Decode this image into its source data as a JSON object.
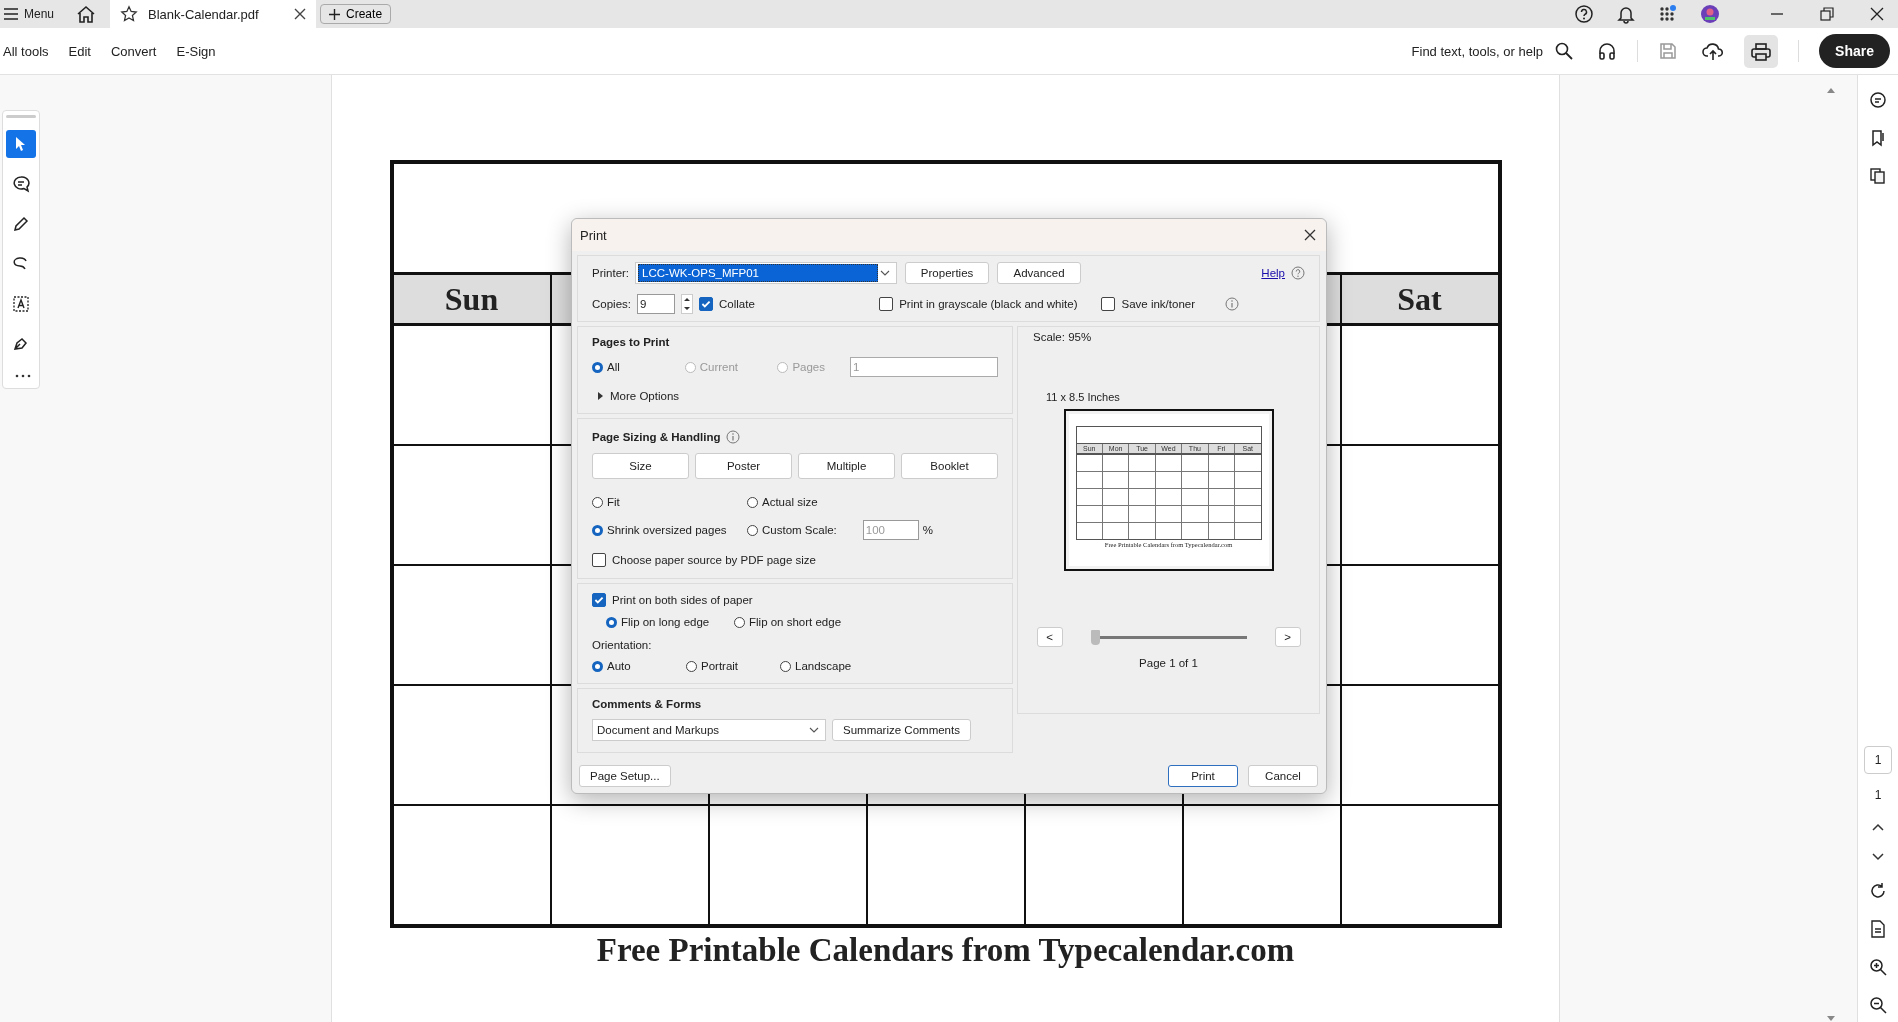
{
  "topbar": {
    "menu": "Menu",
    "tab": {
      "title": "Blank-Calendar.pdf"
    },
    "create": "Create"
  },
  "toolbar": {
    "items": [
      "All tools",
      "Edit",
      "Convert",
      "E-Sign"
    ],
    "search": "Find text, tools, or help",
    "share": "Share"
  },
  "tools": [
    {
      "selected": true
    },
    {
      "selected": false
    },
    {
      "selected": false
    },
    {
      "selected": false
    },
    {
      "selected": false
    },
    {
      "selected": false
    }
  ],
  "calendar": {
    "headers": [
      "Sun",
      "Sat"
    ],
    "footer": "Free Printable Calendars from Typecalendar.com"
  },
  "pager": {
    "current": "1",
    "total": "1"
  },
  "dialog": {
    "title": "Print",
    "printer": {
      "label": "Printer:",
      "value": "LCC-WK-OPS_MFP01"
    },
    "top_buttons": [
      "Properties",
      "Advanced"
    ],
    "help": "Help",
    "copies": {
      "label": "Copies:",
      "value": "9"
    },
    "collate": {
      "label": "Collate",
      "checked": true
    },
    "grayscale": {
      "label": "Print in grayscale (black and white)",
      "checked": false
    },
    "save_ink": {
      "label": "Save ink/toner",
      "checked": false
    },
    "pages_to_print": {
      "title": "Pages to Print",
      "options": [
        {
          "label": "All",
          "selected": true,
          "disabled": false
        },
        {
          "label": "Current",
          "selected": false,
          "disabled": true
        },
        {
          "label": "Pages",
          "selected": false,
          "disabled": true
        }
      ],
      "pages_value": "1",
      "more_options": {
        "label": "More Options",
        "expanded": false
      }
    },
    "sizing": {
      "title": "Page Sizing & Handling",
      "tabs": [
        "Size",
        "Poster",
        "Multiple",
        "Booklet"
      ],
      "options": [
        {
          "label": "Fit",
          "selected": false
        },
        {
          "label": "Actual size",
          "selected": false
        },
        {
          "label": "Shrink oversized pages",
          "selected": true
        },
        {
          "label": "Custom Scale:",
          "selected": false
        }
      ],
      "scale_value": "100",
      "percent": "%",
      "paper_source": {
        "label": "Choose paper source by PDF page size",
        "checked": false
      }
    },
    "duplex": {
      "label": "Print on both sides of paper",
      "checked": true,
      "options": [
        {
          "label": "Flip on long edge",
          "selected": true
        },
        {
          "label": "Flip on short edge",
          "selected": false
        }
      ]
    },
    "orientation": {
      "title": "Orientation:",
      "options": [
        {
          "label": "Auto",
          "selected": true
        },
        {
          "label": "Portrait",
          "selected": false
        },
        {
          "label": "Landscape",
          "selected": false
        }
      ]
    },
    "comments": {
      "title": "Comments & Forms",
      "value": "Document and Markups",
      "button": "Summarize Comments"
    },
    "preview": {
      "scale": "Scale:  95%",
      "paper": "11 x 8.5 Inches",
      "days": [
        "Sun",
        "Mon",
        "Tue",
        "Wed",
        "Thu",
        "Fri",
        "Sat"
      ],
      "footer": "Free Printable Calendars from Typecalendar.com",
      "prev": "<",
      "next": ">",
      "level": 0,
      "page": "Page 1 of 1"
    },
    "buttons": {
      "setup": "Page Setup...",
      "print": "Print",
      "cancel": "Cancel"
    }
  }
}
